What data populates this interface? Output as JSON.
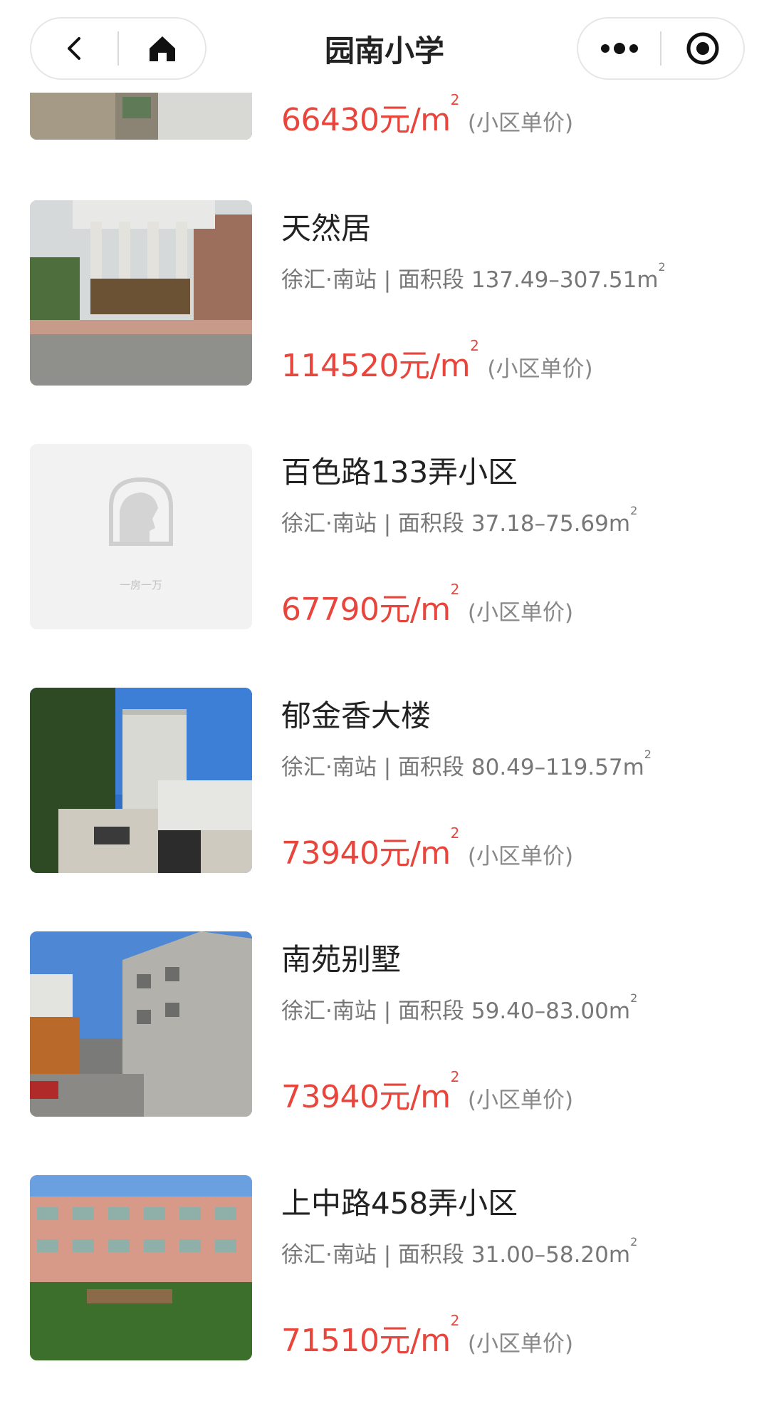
{
  "header": {
    "title": "园南小学",
    "back_icon": "chevron-left-icon",
    "home_icon": "home-icon",
    "more_icon": "more-dots-icon",
    "close_icon": "target-close-icon"
  },
  "price_suffix": "(小区单价)",
  "items": [
    {
      "price": "66430元/m",
      "image": "gate-building-photo"
    },
    {
      "name": "天然居",
      "area": "徐汇·南站",
      "range_label": "面积段",
      "range": "137.49–307.51m",
      "price": "114520元/m",
      "image": "pavilion-gate-photo"
    },
    {
      "name": "百色路133弄小区",
      "area": "徐汇·南站",
      "range_label": "面积段",
      "range": "37.18–75.69m",
      "price": "67790元/m",
      "image": "placeholder-logo",
      "placeholder_caption": "一房一万"
    },
    {
      "name": "郁金香大楼",
      "area": "徐汇·南站",
      "range_label": "面积段",
      "range": "80.49–119.57m",
      "price": "73940元/m",
      "image": "tower-building-photo"
    },
    {
      "name": "南苑别墅",
      "area": "徐汇·南站",
      "range_label": "面积段",
      "range": "59.40–83.00m",
      "price": "73940元/m",
      "image": "street-building-photo"
    },
    {
      "name": "上中路458弄小区",
      "area": "徐汇·南站",
      "range_label": "面积段",
      "range": "31.00–58.20m",
      "price": "71510元/m",
      "image": "apartment-block-photo"
    }
  ]
}
